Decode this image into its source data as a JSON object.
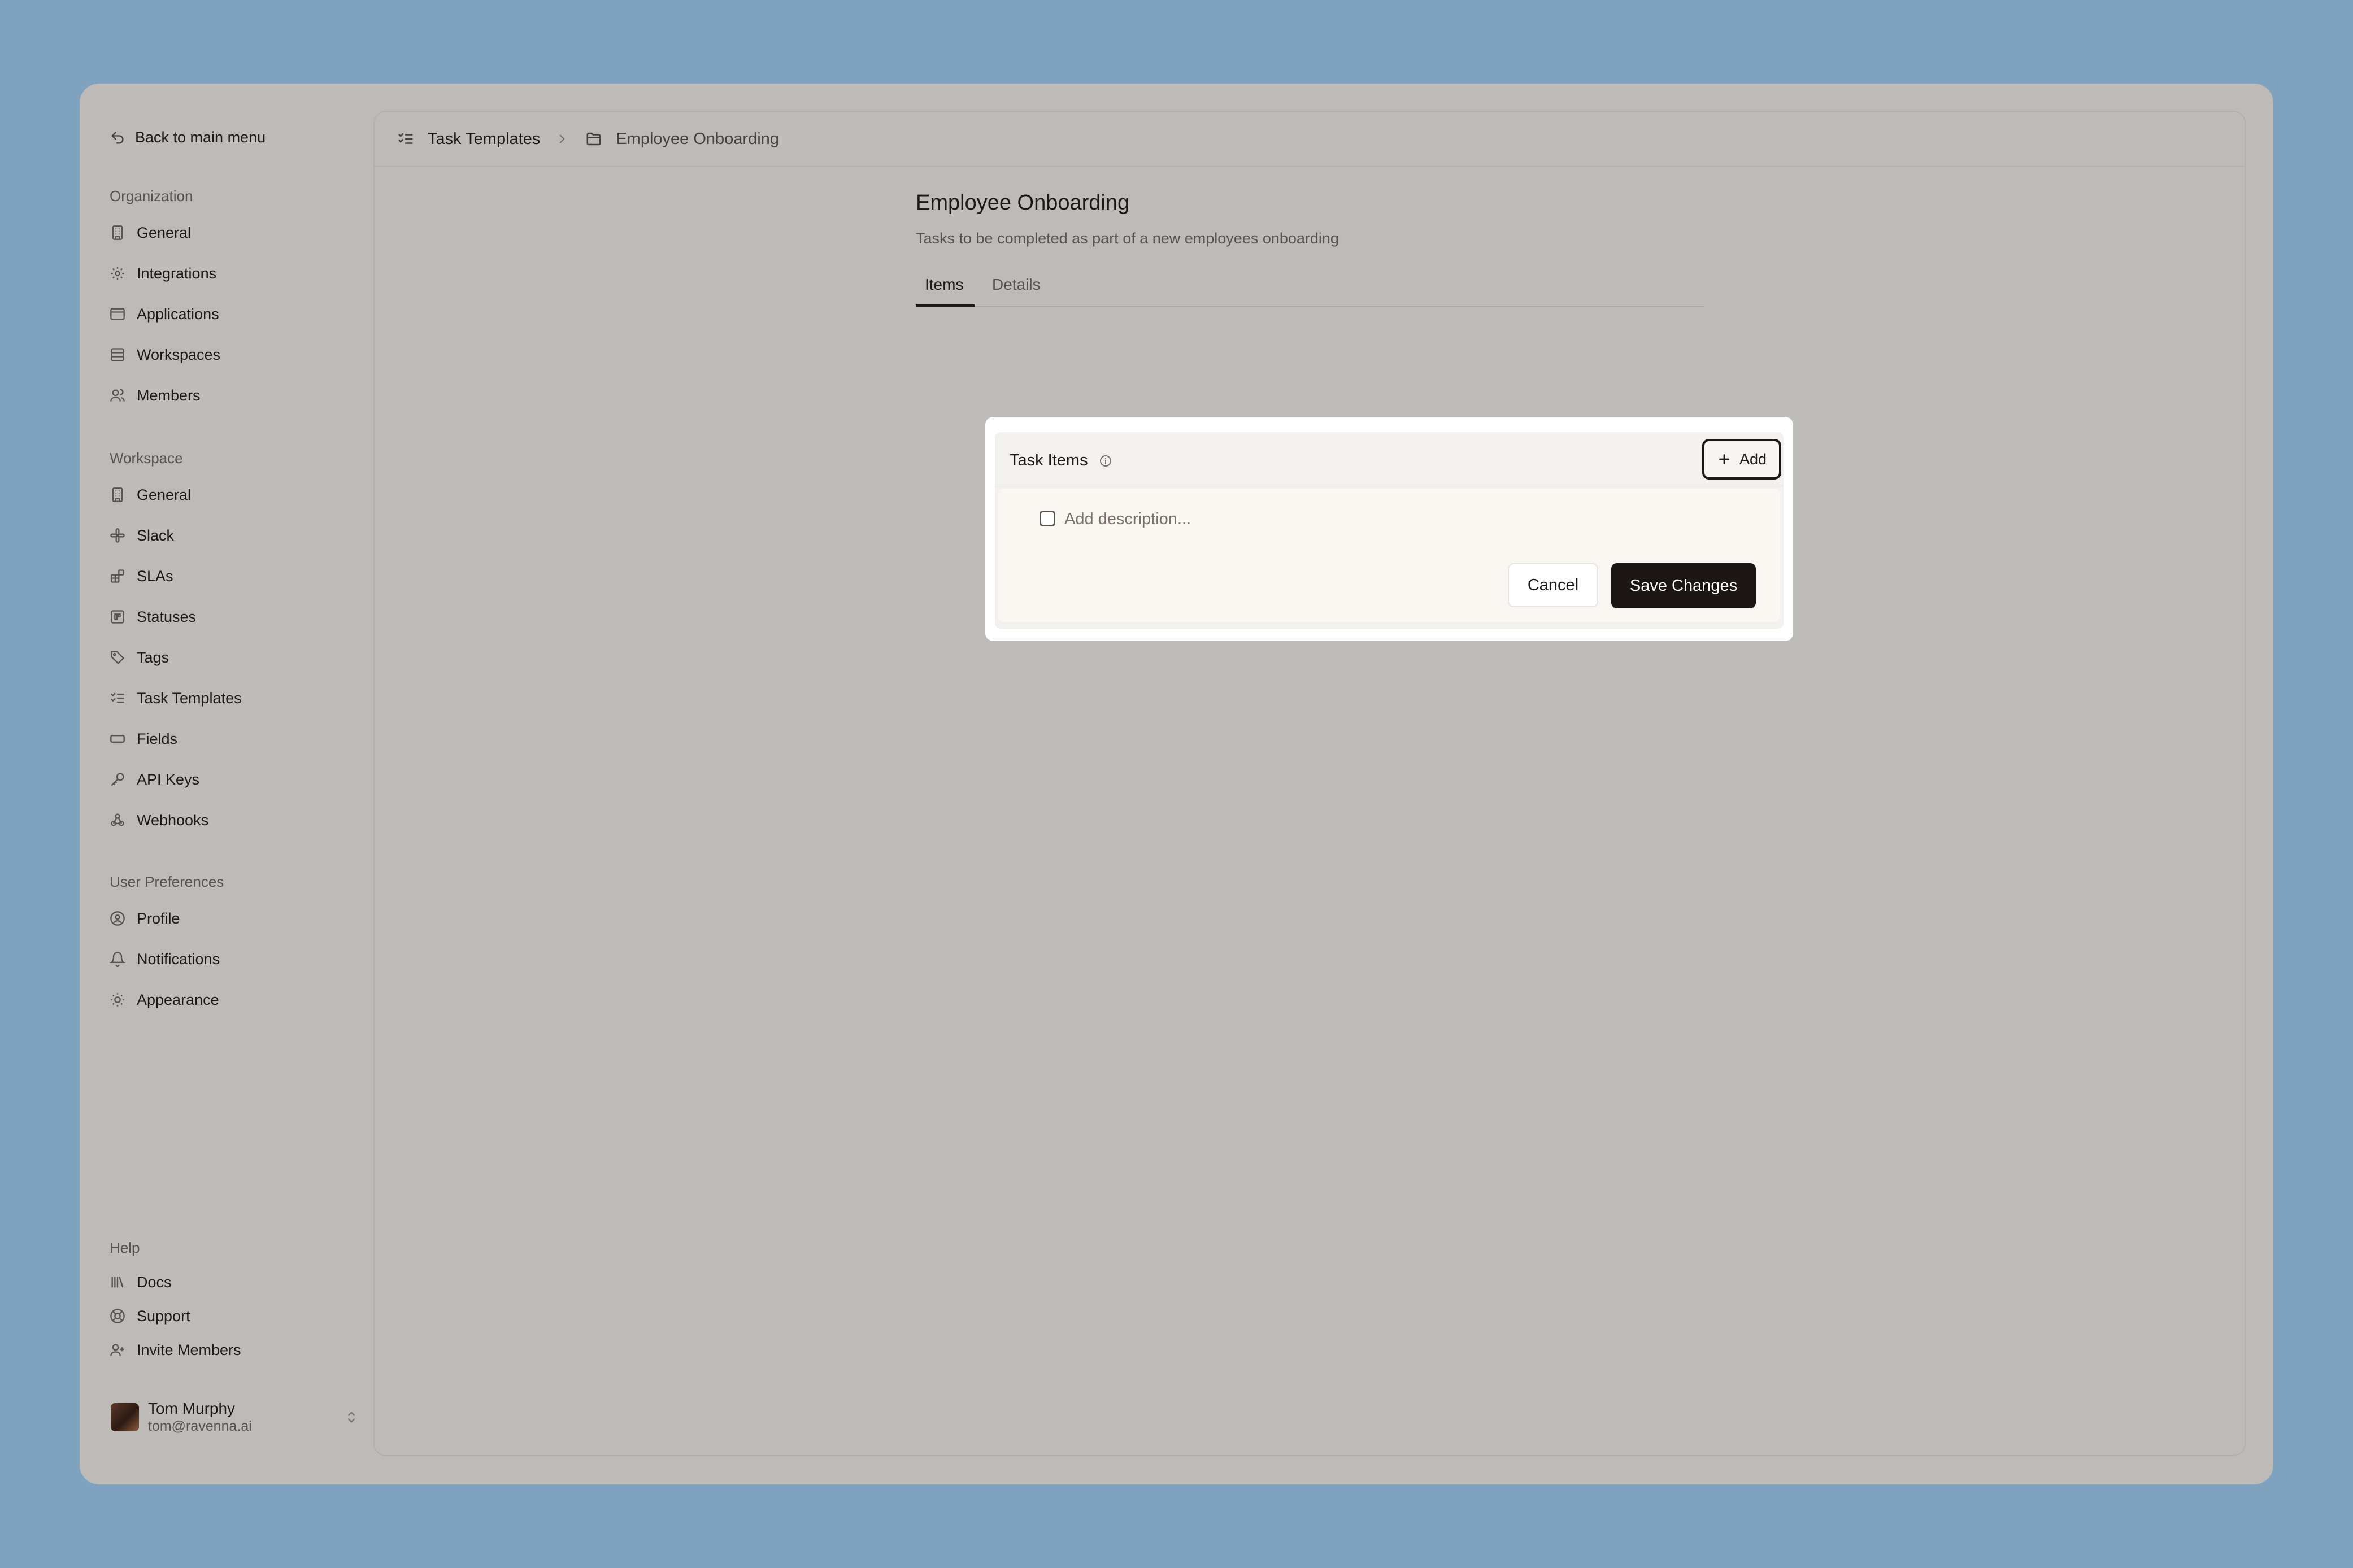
{
  "sidebar": {
    "back_label": "Back to main menu",
    "sections": [
      {
        "label": "Organization",
        "items": [
          {
            "label": "General",
            "icon": "building-icon"
          },
          {
            "label": "Integrations",
            "icon": "gear-icon"
          },
          {
            "label": "Applications",
            "icon": "app-window-icon"
          },
          {
            "label": "Workspaces",
            "icon": "list-icon"
          },
          {
            "label": "Members",
            "icon": "users-icon"
          }
        ]
      },
      {
        "label": "Workspace",
        "items": [
          {
            "label": "General",
            "icon": "building-icon"
          },
          {
            "label": "Slack",
            "icon": "slack-icon"
          },
          {
            "label": "SLAs",
            "icon": "blocks-icon"
          },
          {
            "label": "Statuses",
            "icon": "status-icon"
          },
          {
            "label": "Tags",
            "icon": "tag-icon"
          },
          {
            "label": "Task Templates",
            "icon": "checklist-icon"
          },
          {
            "label": "Fields",
            "icon": "field-icon"
          },
          {
            "label": "API Keys",
            "icon": "key-icon"
          },
          {
            "label": "Webhooks",
            "icon": "webhook-icon"
          }
        ]
      },
      {
        "label": "User Preferences",
        "items": [
          {
            "label": "Profile",
            "icon": "user-circle-icon"
          },
          {
            "label": "Notifications",
            "icon": "bell-icon"
          },
          {
            "label": "Appearance",
            "icon": "sun-icon"
          }
        ]
      },
      {
        "label": "Help",
        "items": [
          {
            "label": "Docs",
            "icon": "library-icon"
          },
          {
            "label": "Support",
            "icon": "life-buoy-icon"
          },
          {
            "label": "Invite Members",
            "icon": "user-plus-icon"
          }
        ]
      }
    ],
    "user": {
      "name": "Tom Murphy",
      "email": "tom@ravenna.ai"
    }
  },
  "breadcrumb": {
    "parent": "Task Templates",
    "current": "Employee Onboarding"
  },
  "page": {
    "title": "Employee Onboarding",
    "subtitle": "Tasks to be completed as part of a new employees onboarding",
    "tabs": [
      {
        "label": "Items",
        "active": true
      },
      {
        "label": "Details",
        "active": false
      }
    ]
  },
  "task_items": {
    "title": "Task Items",
    "add_label": "Add",
    "description_placeholder": "Add description...",
    "description_value": "",
    "cancel_label": "Cancel",
    "save_label": "Save Changes"
  },
  "colors": {
    "backdrop": "#7fa3bf",
    "app_background": "#bdbbb7",
    "primary_button": "#1c1614",
    "text": "#1c1917"
  }
}
